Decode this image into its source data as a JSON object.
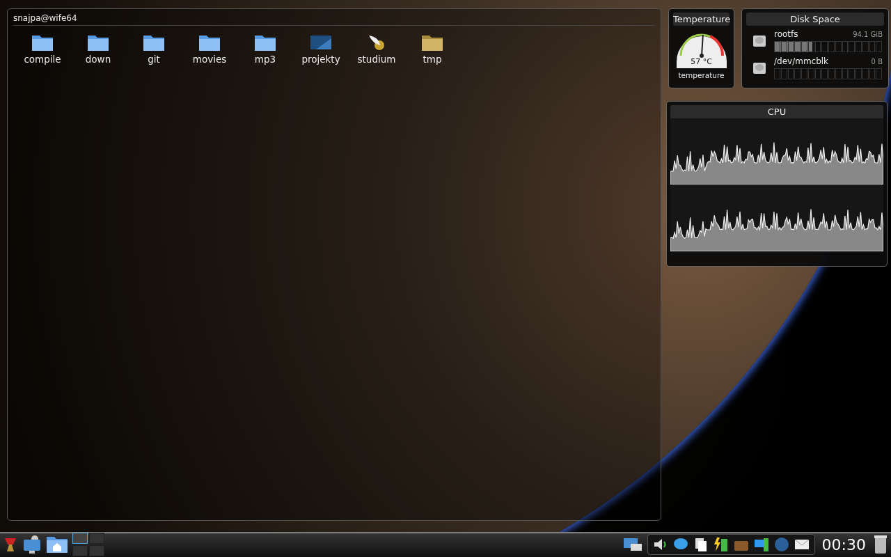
{
  "folder_view": {
    "title": "snajpa@wife64",
    "items": [
      {
        "label": "compile",
        "kind": "folder"
      },
      {
        "label": "down",
        "kind": "folder"
      },
      {
        "label": "git",
        "kind": "folder"
      },
      {
        "label": "movies",
        "kind": "folder"
      },
      {
        "label": "mp3",
        "kind": "folder"
      },
      {
        "label": "projekty",
        "kind": "projects"
      },
      {
        "label": "studium",
        "kind": "quill"
      },
      {
        "label": "tmp",
        "kind": "yellow-folder"
      }
    ]
  },
  "temperature": {
    "title": "Temperature",
    "reading": "57 °C",
    "label": "temperature",
    "level": 0.52
  },
  "disk_space": {
    "title": "Disk Space",
    "disks": [
      {
        "name": "rootfs",
        "size": "94.1 GiB",
        "level": 0.35
      },
      {
        "name": "/dev/mmcblk",
        "size": "0 B",
        "level": 0
      }
    ]
  },
  "cpu": {
    "title": "CPU"
  },
  "panel": {
    "desktops": [
      {
        "selected": true
      },
      {
        "selected": false
      },
      {
        "selected": false
      },
      {
        "selected": false
      }
    ],
    "clock": "00:30"
  }
}
